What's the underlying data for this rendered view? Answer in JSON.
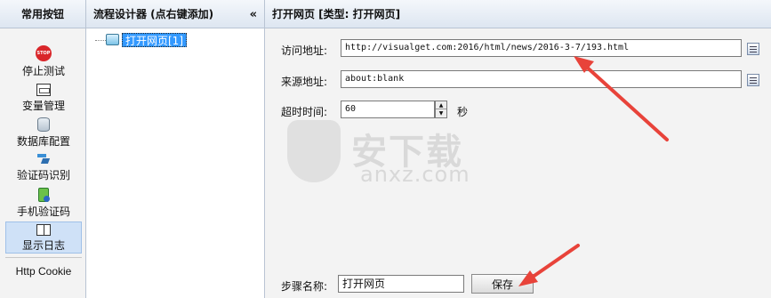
{
  "toolbox": {
    "title": "常用按钮",
    "items": [
      {
        "label": "停止测试",
        "icon": "stop-icon",
        "icon_text": "STOP"
      },
      {
        "label": "变量管理",
        "icon": "variable-icon"
      },
      {
        "label": "数据库配置",
        "icon": "database-icon"
      },
      {
        "label": "验证码识别",
        "icon": "captcha-icon"
      },
      {
        "label": "手机验证码",
        "icon": "phone-icon"
      },
      {
        "label": "显示日志",
        "icon": "log-icon"
      },
      {
        "label": "Http Cookie"
      }
    ]
  },
  "designer": {
    "title": "流程设计器 (点右键添加)",
    "collapse": "«",
    "node": "打开网页[1]"
  },
  "properties": {
    "title": "打开网页 [类型: 打开网页]",
    "url_label": "访问地址:",
    "url_value": "http://visualget.com:2016/html/news/2016-3-7/193.html",
    "referer_label": "来源地址:",
    "referer_value": "about:blank",
    "timeout_label": "超时时间:",
    "timeout_value": "60",
    "timeout_unit": "秒",
    "step_label": "步骤名称:",
    "step_value": "打开网页",
    "save_label": "保存"
  },
  "watermark": {
    "cn": "安下载",
    "en": "anxz.com"
  },
  "colors": {
    "selected_node": "#3399ff",
    "arrow": "#e8433a",
    "header_gradient_top": "#f4f7fb",
    "header_gradient_bottom": "#dde6f1"
  }
}
